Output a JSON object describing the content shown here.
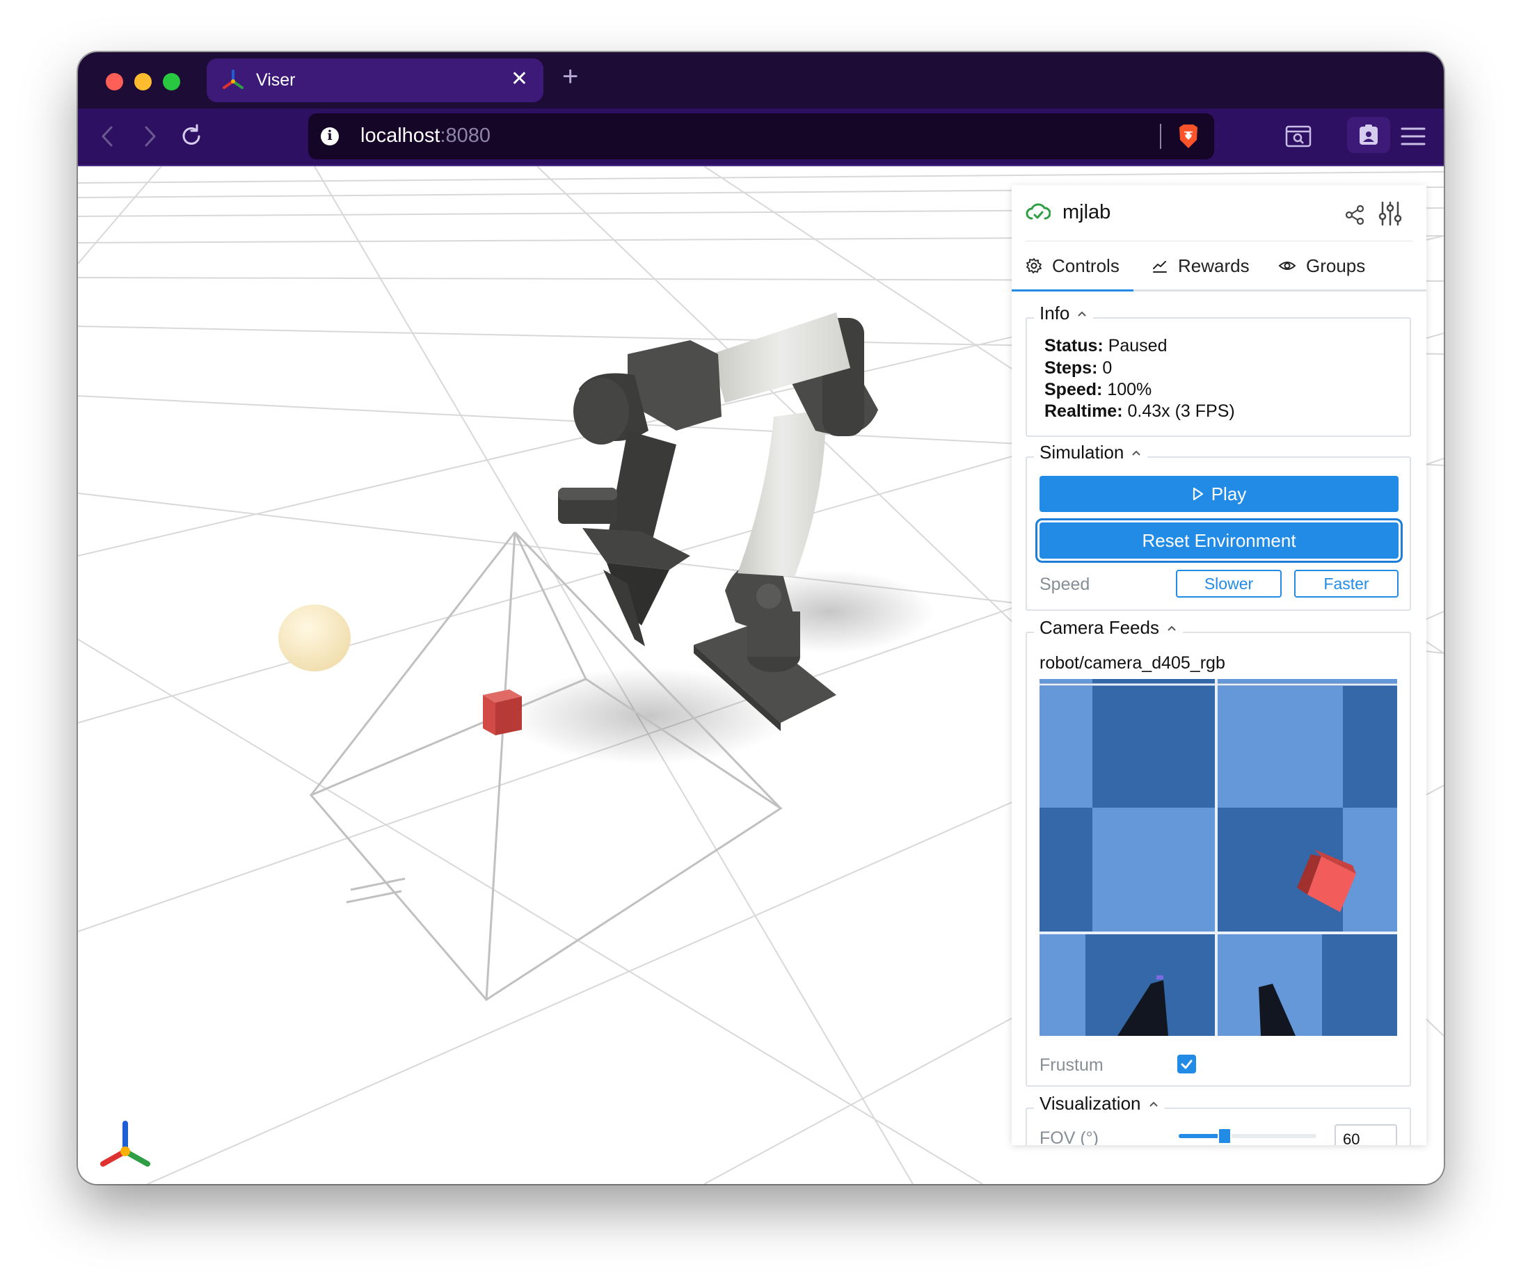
{
  "browser": {
    "tab_title": "Viser",
    "tab_close": "✕",
    "new_tab": "+",
    "url_host": "localhost",
    "url_port": ":8080"
  },
  "panel": {
    "title": "mjlab",
    "tabs": [
      {
        "label": "Controls",
        "icon": "gear-icon",
        "active": true
      },
      {
        "label": "Rewards",
        "icon": "chart-line-icon",
        "active": false
      },
      {
        "label": "Groups",
        "icon": "eye-icon",
        "active": false
      }
    ],
    "info": {
      "legend": "Info",
      "rows": [
        {
          "key": "Status:",
          "value": "Paused"
        },
        {
          "key": "Steps:",
          "value": "0"
        },
        {
          "key": "Speed:",
          "value": "100%"
        },
        {
          "key": "Realtime:",
          "value": "0.43x (3 FPS)"
        }
      ]
    },
    "simulation": {
      "legend": "Simulation",
      "play_label": "Play",
      "reset_label": "Reset Environment",
      "speed_label": "Speed",
      "slower_label": "Slower",
      "faster_label": "Faster"
    },
    "camera_feeds": {
      "legend": "Camera Feeds",
      "feed_name": "robot/camera_d405_rgb",
      "frustum_label": "Frustum",
      "frustum_checked": true
    },
    "visualization": {
      "legend": "Visualization",
      "fov_label": "FOV (°)",
      "fov_min": "20",
      "fov_max": "150",
      "fov_value": "60"
    }
  },
  "colors": {
    "accent": "#228be6",
    "titlebar": "#1d0c36",
    "toolbar": "#2e1063",
    "tab_active": "#3d1a78"
  }
}
